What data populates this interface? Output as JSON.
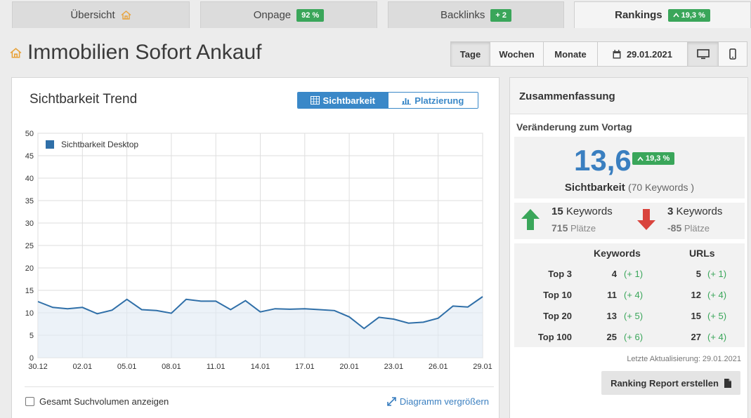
{
  "tabs": [
    {
      "label": "Übersicht",
      "badge": ""
    },
    {
      "label": "Onpage",
      "badge": "92 %"
    },
    {
      "label": "Backlinks",
      "badge": "+ 2"
    },
    {
      "label": "Rankings",
      "badge": "19,3 %"
    }
  ],
  "page": {
    "title": "Immobilien Sofort Ankauf"
  },
  "period": {
    "day": "Tage",
    "week": "Wochen",
    "month": "Monate",
    "date": "29.01.2021",
    "calendar_icon": "calendar-icon",
    "desktop_icon": "desktop-icon",
    "mobile_icon": "mobile-icon"
  },
  "chart_panel": {
    "title": "Sichtbarkeit Trend",
    "toggle_visibility": "Sichtbarkeit",
    "toggle_ranking": "Platzierung",
    "checkbox_label": "Gesamt Suchvolumen anzeigen",
    "enlarge_label": "Diagramm vergrößern"
  },
  "chart_data": {
    "type": "area",
    "x": [
      "30.12",
      "31.12",
      "01.01",
      "02.01",
      "03.01",
      "04.01",
      "05.01",
      "06.01",
      "07.01",
      "08.01",
      "09.01",
      "10.01",
      "11.01",
      "12.01",
      "13.01",
      "14.01",
      "15.01",
      "16.01",
      "17.01",
      "18.01",
      "19.01",
      "20.01",
      "21.01",
      "22.01",
      "23.01",
      "24.01",
      "25.01",
      "26.01",
      "27.01",
      "28.01",
      "29.01"
    ],
    "tick_labels": [
      "30.12",
      "02.01",
      "05.01",
      "08.01",
      "11.01",
      "14.01",
      "17.01",
      "20.01",
      "23.01",
      "26.01",
      "29.01"
    ],
    "series": [
      {
        "name": "Sichtbarkeit Desktop",
        "values": [
          12.5,
          11.2,
          10.9,
          11.2,
          9.8,
          10.6,
          13.0,
          10.7,
          10.5,
          9.9,
          13.0,
          12.6,
          12.6,
          10.7,
          12.7,
          10.2,
          10.9,
          10.8,
          10.9,
          10.7,
          10.5,
          9.1,
          6.5,
          9.0,
          8.6,
          7.7,
          7.9,
          8.8,
          11.5,
          11.3,
          13.6
        ]
      }
    ],
    "ylim": [
      0,
      50
    ],
    "yticks": [
      0,
      5,
      10,
      15,
      20,
      25,
      30,
      35,
      40,
      45,
      50
    ],
    "grid": true,
    "legend": "top-left",
    "color": "#2f6fa8"
  },
  "summary": {
    "title": "Zusammenfassung",
    "subtitle": "Veränderung zum Vortag",
    "big_value": "13,6",
    "big_badge": "19,3 %",
    "big_label": "Sichtbarkeit",
    "keywords_count": "(70 Keywords )",
    "up": {
      "count": "15",
      "label": "Keywords",
      "places": "715",
      "places_label": "Plätze"
    },
    "down": {
      "count": "3",
      "label": "Keywords",
      "places": "-85",
      "places_label": "Plätze"
    },
    "table": {
      "headers": [
        "Keywords",
        "URLs"
      ],
      "rows": [
        {
          "label": "Top 3",
          "kw": "4",
          "kw_delta": "(+ 1)",
          "url": "5",
          "url_delta": "(+ 1)"
        },
        {
          "label": "Top 10",
          "kw": "11",
          "kw_delta": "(+ 4)",
          "url": "12",
          "url_delta": "(+ 4)"
        },
        {
          "label": "Top 20",
          "kw": "13",
          "kw_delta": "(+ 5)",
          "url": "15",
          "url_delta": "(+ 5)"
        },
        {
          "label": "Top 100",
          "kw": "25",
          "kw_delta": "(+ 6)",
          "url": "27",
          "url_delta": "(+ 4)"
        }
      ]
    },
    "last_update": "Letzte Aktualisierung: 29.01.2021",
    "report_button": "Ranking Report erstellen"
  },
  "colors": {
    "accent": "#3a88c8",
    "success": "#3aa65a",
    "danger": "#d9443d",
    "house": "#e8a23a"
  }
}
